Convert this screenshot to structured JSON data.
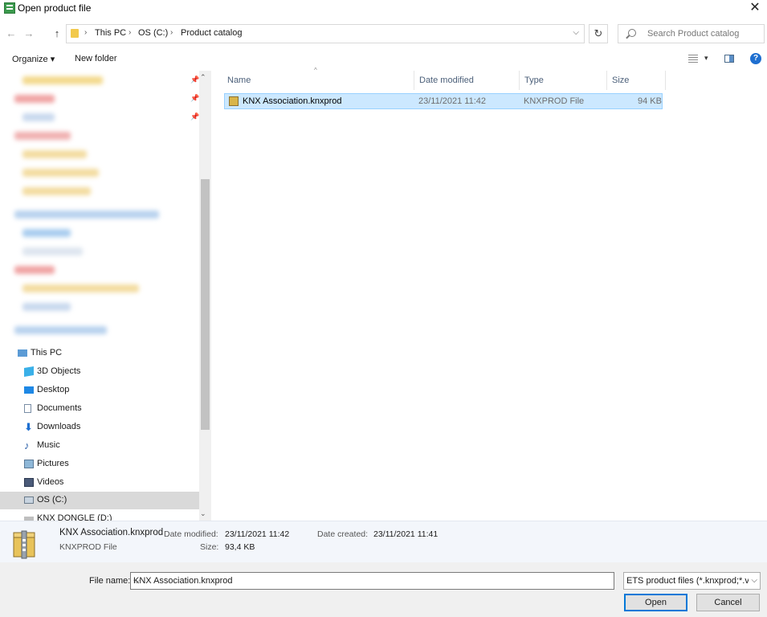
{
  "window": {
    "title": "Open product file",
    "close": "✕"
  },
  "address": {
    "crumbs": [
      "This PC",
      "OS (C:)",
      "Product catalog"
    ],
    "back": "←",
    "forward": "→",
    "up": "↑",
    "refresh": "↻",
    "dropdown": "⌵"
  },
  "search": {
    "placeholder": "Search Product catalog"
  },
  "toolbar": {
    "organize": "Organize ▾",
    "new_folder": "New folder",
    "help": "?"
  },
  "nav": {
    "items": [
      {
        "label": "This PC"
      },
      {
        "label": "3D Objects"
      },
      {
        "label": "Desktop"
      },
      {
        "label": "Documents"
      },
      {
        "label": "Downloads"
      },
      {
        "label": "Music"
      },
      {
        "label": "Pictures"
      },
      {
        "label": "Videos"
      },
      {
        "label": "OS (C:)"
      },
      {
        "label": "KNX DONGLE (D:)"
      }
    ]
  },
  "list": {
    "columns": [
      "Name",
      "Date modified",
      "Type",
      "Size"
    ],
    "rows": [
      {
        "name": "KNX Association.knxprod",
        "date": "23/11/2021 11:42",
        "type": "KNXPROD File",
        "size": "94 KB"
      }
    ]
  },
  "details": {
    "name": "KNX Association.knxprod",
    "type": "KNXPROD File",
    "modified_label": "Date modified:",
    "modified": "23/11/2021 11:42",
    "size_label": "Size:",
    "size": "93,4 KB",
    "created_label": "Date created:",
    "created": "23/11/2021 11:41"
  },
  "footer": {
    "filename_label": "File name:",
    "filename": "KNX Association.knxprod",
    "filter": "ETS product files (*.knxprod;*.vd>",
    "open": "Open",
    "cancel": "Cancel"
  }
}
